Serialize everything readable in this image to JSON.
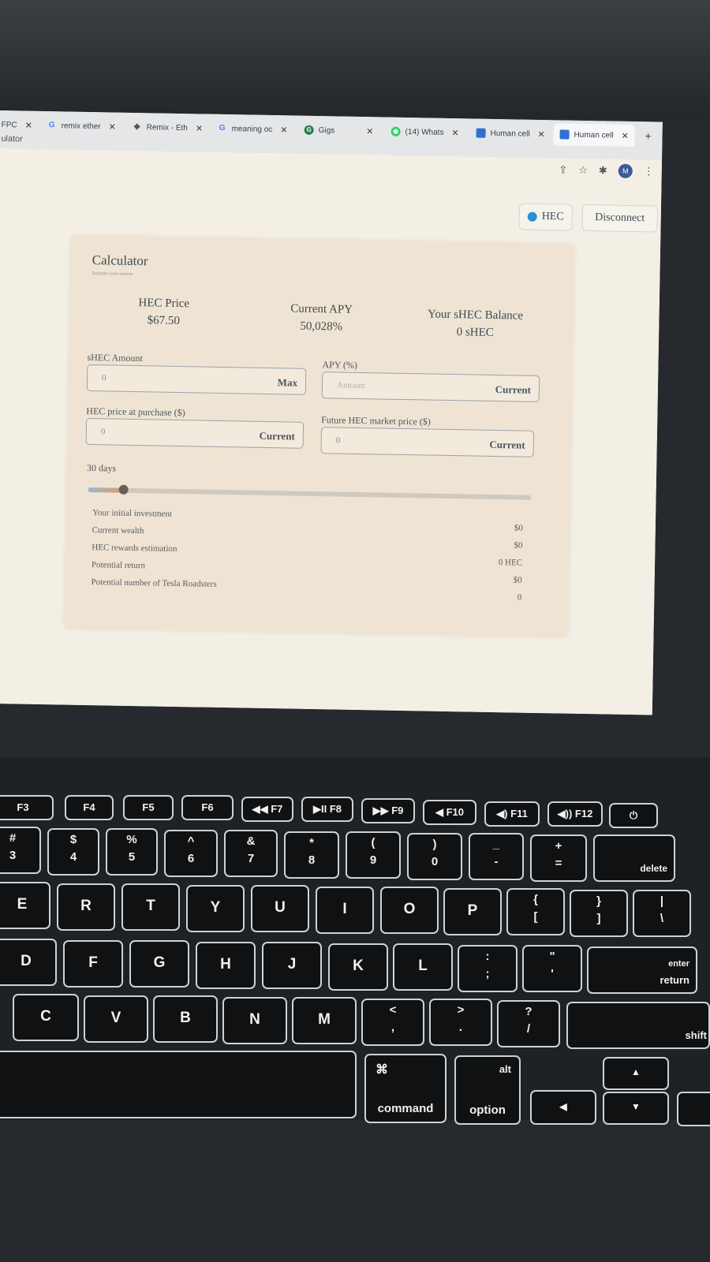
{
  "browser": {
    "tabs": [
      {
        "label": "FPC",
        "icon": "page-icon"
      },
      {
        "label": "remix ether",
        "icon": "google-icon"
      },
      {
        "label": "Remix - Eth",
        "icon": "remix-icon"
      },
      {
        "label": "meaning oc",
        "icon": "google-icon"
      },
      {
        "label": "Gigs",
        "icon": "gigs-icon"
      },
      {
        "label": "(14) Whats",
        "icon": "whatsapp-icon"
      },
      {
        "label": "Human cell",
        "icon": "page-icon"
      },
      {
        "label": "Human cell",
        "icon": "page-icon"
      }
    ],
    "address_partial": "ulator",
    "avatar_initial": "M"
  },
  "header": {
    "network_label": "HEC",
    "disconnect_label": "Disconnect"
  },
  "calculator": {
    "title": "Calculator",
    "subtitle": "Estimate your returns",
    "stats": [
      {
        "label": "HEC Price",
        "value": "$67.50"
      },
      {
        "label": "Current APY",
        "value": "50,028%"
      },
      {
        "label": "Your sHEC Balance",
        "value": "0 sHEC"
      }
    ],
    "shec_amount": {
      "label": "sHEC Amount",
      "value": "0",
      "button": "Max"
    },
    "apy": {
      "label": "APY (%)",
      "placeholder": "Amount",
      "button": "Current"
    },
    "purchase_price": {
      "label": "HEC price at purchase ($)",
      "value": "0",
      "button": "Current"
    },
    "future_price": {
      "label": "Future HEC market price ($)",
      "value": "0",
      "button": "Current"
    },
    "days_label": "30 days",
    "slider_fraction": 0.08,
    "results": [
      {
        "label": "Your initial investment",
        "value": "$0"
      },
      {
        "label": "Current wealth",
        "value": "$0"
      },
      {
        "label": "HEC rewards estimation",
        "value": "0 HEC"
      },
      {
        "label": "Potential return",
        "value": "$0"
      },
      {
        "label": "Potential number of Tesla Roadsters",
        "value": "0"
      }
    ]
  },
  "keyboard": {
    "fn_row": [
      {
        "main": "F3",
        "icon": "mission-control-icon"
      },
      {
        "main": "F4",
        "icon": "launchpad-icon"
      },
      {
        "main": "F5",
        "icon": "keyboard-light-down-icon"
      },
      {
        "main": "F6",
        "icon": "keyboard-light-up-icon"
      },
      {
        "main": "◀◀ F7"
      },
      {
        "main": "▶II F8"
      },
      {
        "main": "▶▶ F9"
      },
      {
        "main": "◀ F10"
      },
      {
        "main": "◀) F11"
      },
      {
        "main": "◀)) F12"
      },
      {
        "main": "⏻"
      }
    ],
    "number_row": [
      {
        "upper": "#",
        "lower": "3"
      },
      {
        "upper": "$",
        "lower": "4"
      },
      {
        "upper": "%",
        "lower": "5"
      },
      {
        "upper": "^",
        "lower": "6"
      },
      {
        "upper": "&",
        "lower": "7"
      },
      {
        "upper": "*",
        "lower": "8"
      },
      {
        "upper": "(",
        "lower": "9"
      },
      {
        "upper": ")",
        "lower": "0"
      },
      {
        "upper": "_",
        "lower": "-"
      },
      {
        "upper": "+",
        "lower": "="
      },
      {
        "upper": "",
        "lower": "delete"
      }
    ],
    "qwerty_row": [
      "E",
      "R",
      "T",
      "Y",
      "U",
      "I",
      "O",
      "P",
      {
        "upper": "{",
        "lower": "["
      },
      {
        "upper": "}",
        "lower": "]"
      },
      {
        "upper": "|",
        "lower": "\\"
      }
    ],
    "home_row": [
      "D",
      "F",
      "G",
      "H",
      "J",
      "K",
      "L",
      {
        "upper": ":",
        "lower": ";"
      },
      {
        "upper": "\"",
        "lower": "'"
      },
      {
        "upper": "enter",
        "lower": "return"
      }
    ],
    "bottom_row": [
      "C",
      "V",
      "B",
      "N",
      "M",
      {
        "upper": "<",
        "lower": ","
      },
      {
        "upper": ">",
        "lower": "."
      },
      {
        "upper": "?",
        "lower": "/"
      },
      {
        "upper": "",
        "lower": "shift"
      }
    ],
    "command": {
      "symbol": "⌘",
      "label": "command"
    },
    "option": {
      "symbol": "alt",
      "label": "option"
    },
    "arrows": {
      "up": "▲",
      "down": "▼",
      "left": "◀"
    }
  }
}
